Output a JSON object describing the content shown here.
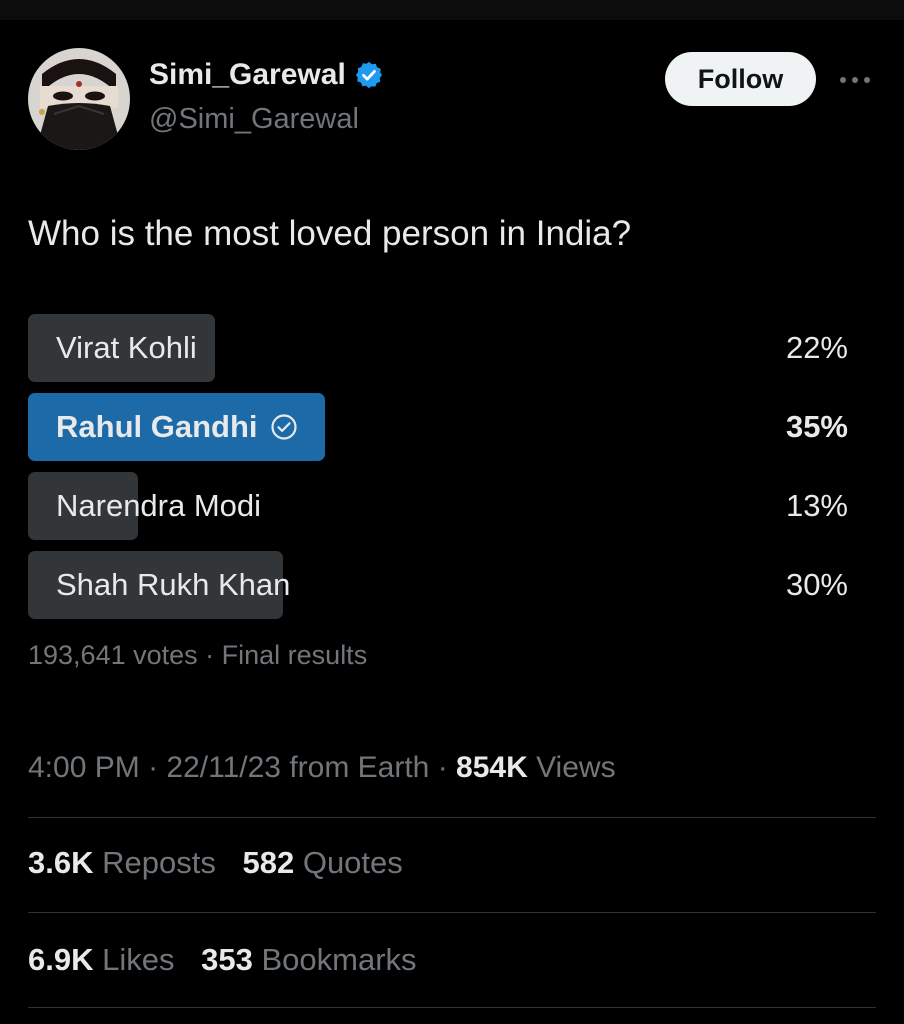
{
  "tweet": {
    "author": {
      "display_name": "Simi_Garewal",
      "handle": "@Simi_Garewal",
      "verified": true
    },
    "follow_label": "Follow",
    "question": "Who is the most loved person in India?",
    "poll": {
      "options": [
        {
          "label": "Virat Kohli",
          "percent_text": "22%",
          "percent": 22,
          "winner": false
        },
        {
          "label": "Rahul Gandhi",
          "percent_text": "35%",
          "percent": 35,
          "winner": true
        },
        {
          "label": "Narendra Modi",
          "percent_text": "13%",
          "percent": 13,
          "winner": false
        },
        {
          "label": "Shah Rukh Khan",
          "percent_text": "30%",
          "percent": 30,
          "winner": false
        }
      ],
      "votes": "193,641 votes",
      "status": "Final results"
    },
    "time": "4:00 PM",
    "date": "22/11/23",
    "source": "from Earth",
    "views_count": "854K",
    "views_label": "Views",
    "reposts_count": "3.6K",
    "reposts_label": "Reposts",
    "quotes_count": "582",
    "quotes_label": "Quotes",
    "likes_count": "6.9K",
    "likes_label": "Likes",
    "bookmarks_count": "353",
    "bookmarks_label": "Bookmarks"
  },
  "colors": {
    "background": "#000000",
    "text": "#e7e9ea",
    "muted": "#71767b",
    "poll_bar": "#333639",
    "poll_winner": "#1d6aa8",
    "verified": "#1d9bf0"
  },
  "icons": {
    "verified": "verified-badge-icon",
    "winner_check": "check-circle-icon",
    "more": "more-horizontal-icon"
  }
}
